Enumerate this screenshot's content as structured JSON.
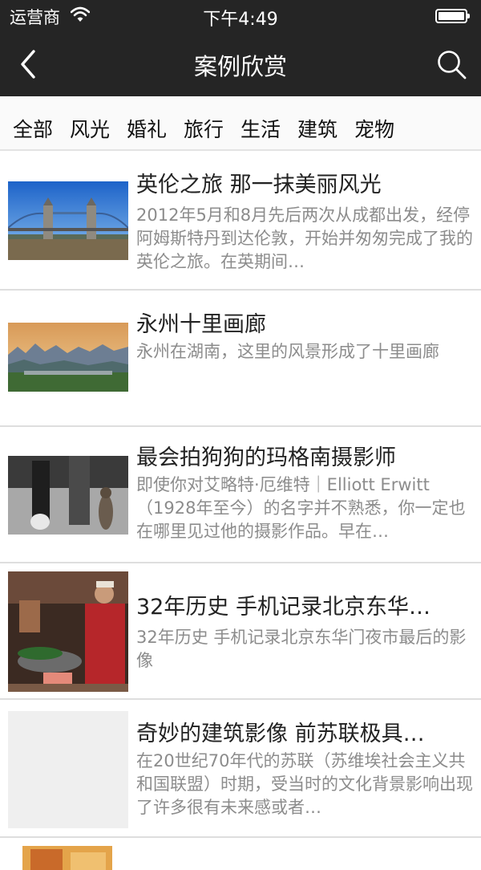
{
  "status_bar": {
    "carrier": "运营商",
    "time": "下午4:49",
    "battery_level": 1.0
  },
  "nav": {
    "title": "案例欣赏",
    "back_icon": "chevron-left-icon",
    "search_icon": "search-icon"
  },
  "categories": [
    "全部",
    "风光",
    "婚礼",
    "旅行",
    "生活",
    "建筑",
    "宠物"
  ],
  "articles": [
    {
      "title": "英伦之旅 那一抹美丽风光",
      "desc": "2012年5月和8月先后两次从成都出发，经停阿姆斯特丹到达伦敦，开始并匆匆完成了我的英伦之旅。在英期间…"
    },
    {
      "title": "永州十里画廊",
      "desc": "永州在湖南，这里的风景形成了十里画廊"
    },
    {
      "title": "最会拍狗狗的玛格南摄影师",
      "desc": "即使你对艾略特·厄维特｜Elliott Erwitt（1928年至今）的名字并不熟悉，你一定也在哪里见过他的摄影作品。早在…"
    },
    {
      "title": "32年历史 手机记录北京东华…",
      "desc": "32年历史 手机记录北京东华门夜市最后的影像"
    },
    {
      "title": "奇妙的建筑影像 前苏联极具…",
      "desc": "在20世纪70年代的苏联（苏维埃社会主义共和国联盟）时期，受当时的文化背景影响出现了许多很有未来感或者…"
    }
  ],
  "colors": {
    "header_bg": "#252525",
    "category_bg": "#fafafa",
    "title_text": "#222222",
    "desc_text": "#8c8c8c"
  }
}
